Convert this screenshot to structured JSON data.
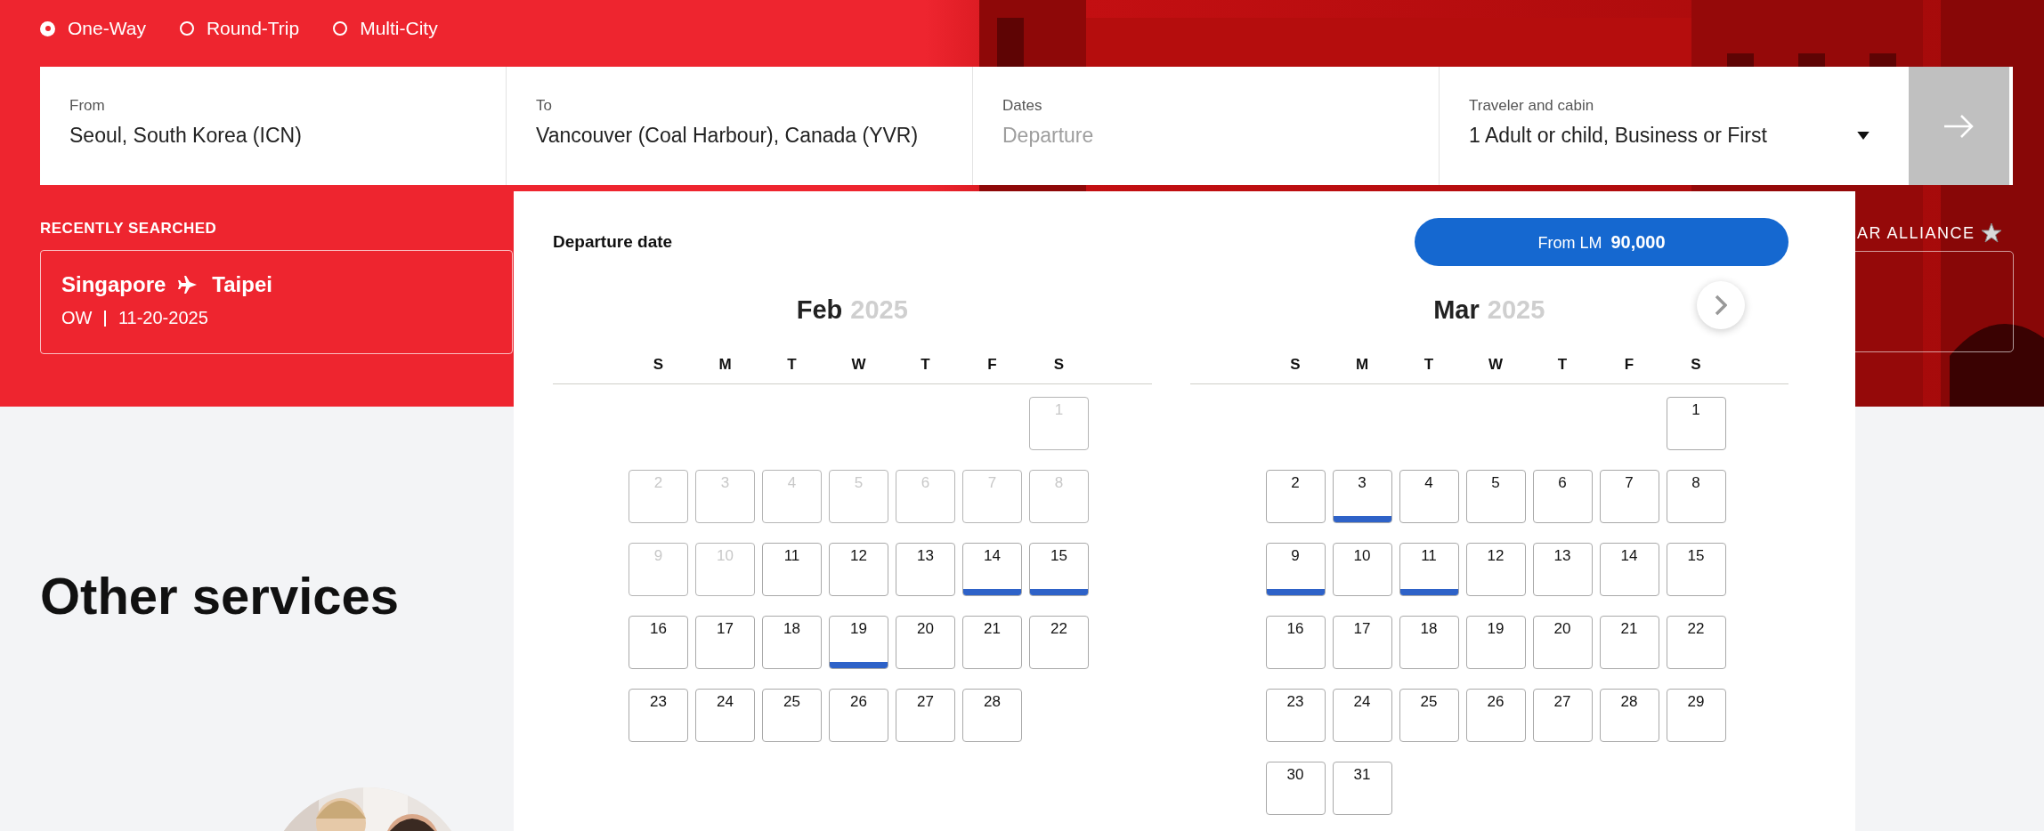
{
  "trip_types": [
    {
      "label": "One-Way",
      "selected": true
    },
    {
      "label": "Round-Trip",
      "selected": false
    },
    {
      "label": "Multi-City",
      "selected": false
    }
  ],
  "search_fields": [
    {
      "kind": "text",
      "label": "From",
      "value": "Seoul, South Korea (ICN)"
    },
    {
      "kind": "text",
      "label": "To",
      "value": "Vancouver (Coal Harbour), Canada (YVR)"
    },
    {
      "kind": "date",
      "label": "Dates",
      "placeholder": "Departure"
    },
    {
      "kind": "dropdown",
      "label": "Traveler and cabin",
      "value": "1 Adult or child, Business or First"
    }
  ],
  "recently_searched": {
    "heading": "RECENTLY SEARCHED",
    "items": [
      {
        "from": "Singapore",
        "to": "Taipei",
        "trip": "OW",
        "date": "11-20-2025"
      }
    ]
  },
  "partner_logo": {
    "text": "AR ALLIANCE"
  },
  "section_heading": "Other services",
  "date_picker": {
    "title": "Departure date",
    "price_button": "From LM  **90,000**",
    "months": [
      {
        "month": "Feb",
        "year": "2025",
        "weekdays": [
          "S",
          "M",
          "T",
          "W",
          "T",
          "F",
          "S"
        ],
        "weeks": [
          {
            "kind": "lead",
            "days": [
              {
                "day": "1",
                "disabled": true,
                "available": false
              }
            ]
          },
          {
            "kind": "week",
            "days": [
              {
                "day": "2",
                "disabled": true,
                "available": false
              },
              {
                "day": "3",
                "disabled": true,
                "available": false
              },
              {
                "day": "4",
                "disabled": true,
                "available": false
              },
              {
                "day": "5",
                "disabled": true,
                "available": false
              },
              {
                "day": "6",
                "disabled": true,
                "available": false
              },
              {
                "day": "7",
                "disabled": true,
                "available": false
              },
              {
                "day": "8",
                "disabled": true,
                "available": false
              }
            ]
          },
          {
            "kind": "week",
            "days": [
              {
                "day": "9",
                "disabled": true,
                "available": false
              },
              {
                "day": "10",
                "disabled": true,
                "available": false
              },
              {
                "day": "11",
                "disabled": false,
                "available": false
              },
              {
                "day": "12",
                "disabled": false,
                "available": false
              },
              {
                "day": "13",
                "disabled": false,
                "available": false
              },
              {
                "day": "14",
                "disabled": false,
                "available": true
              },
              {
                "day": "15",
                "disabled": false,
                "available": true
              }
            ]
          },
          {
            "kind": "week",
            "days": [
              {
                "day": "16",
                "disabled": false,
                "available": false
              },
              {
                "day": "17",
                "disabled": false,
                "available": false
              },
              {
                "day": "18",
                "disabled": false,
                "available": false
              },
              {
                "day": "19",
                "disabled": false,
                "available": true
              },
              {
                "day": "20",
                "disabled": false,
                "available": false
              },
              {
                "day": "21",
                "disabled": false,
                "available": false
              },
              {
                "day": "22",
                "disabled": false,
                "available": false
              }
            ]
          },
          {
            "kind": "week",
            "days": [
              {
                "day": "23",
                "disabled": false,
                "available": false
              },
              {
                "day": "24",
                "disabled": false,
                "available": false
              },
              {
                "day": "25",
                "disabled": false,
                "available": false
              },
              {
                "day": "26",
                "disabled": false,
                "available": false
              },
              {
                "day": "27",
                "disabled": false,
                "available": false
              },
              {
                "day": "28",
                "disabled": false,
                "available": false
              }
            ]
          }
        ]
      },
      {
        "month": "Mar",
        "year": "2025",
        "weekdays": [
          "S",
          "M",
          "T",
          "W",
          "T",
          "F",
          "S"
        ],
        "weeks": [
          {
            "kind": "lead",
            "days": [
              {
                "day": "1",
                "disabled": false,
                "available": false
              }
            ]
          },
          {
            "kind": "week",
            "days": [
              {
                "day": "2",
                "disabled": false,
                "available": false
              },
              {
                "day": "3",
                "disabled": false,
                "available": true
              },
              {
                "day": "4",
                "disabled": false,
                "available": false
              },
              {
                "day": "5",
                "disabled": false,
                "available": false
              },
              {
                "day": "6",
                "disabled": false,
                "available": false
              },
              {
                "day": "7",
                "disabled": false,
                "available": false
              },
              {
                "day": "8",
                "disabled": false,
                "available": false
              }
            ]
          },
          {
            "kind": "week",
            "days": [
              {
                "day": "9",
                "disabled": false,
                "available": true
              },
              {
                "day": "10",
                "disabled": false,
                "available": false
              },
              {
                "day": "11",
                "disabled": false,
                "available": true
              },
              {
                "day": "12",
                "disabled": false,
                "available": false
              },
              {
                "day": "13",
                "disabled": false,
                "available": false
              },
              {
                "day": "14",
                "disabled": false,
                "available": false
              },
              {
                "day": "15",
                "disabled": false,
                "available": false
              }
            ]
          },
          {
            "kind": "week",
            "days": [
              {
                "day": "16",
                "disabled": false,
                "available": false
              },
              {
                "day": "17",
                "disabled": false,
                "available": false
              },
              {
                "day": "18",
                "disabled": false,
                "available": false
              },
              {
                "day": "19",
                "disabled": false,
                "available": false
              },
              {
                "day": "20",
                "disabled": false,
                "available": false
              },
              {
                "day": "21",
                "disabled": false,
                "available": false
              },
              {
                "day": "22",
                "disabled": false,
                "available": false
              }
            ]
          },
          {
            "kind": "week",
            "days": [
              {
                "day": "23",
                "disabled": false,
                "available": false
              },
              {
                "day": "24",
                "disabled": false,
                "available": false
              },
              {
                "day": "25",
                "disabled": false,
                "available": false
              },
              {
                "day": "26",
                "disabled": false,
                "available": false
              },
              {
                "day": "27",
                "disabled": false,
                "available": false
              },
              {
                "day": "28",
                "disabled": false,
                "available": false
              },
              {
                "day": "29",
                "disabled": false,
                "available": false
              }
            ]
          },
          {
            "kind": "week",
            "days": [
              {
                "day": "30",
                "disabled": false,
                "available": false
              },
              {
                "day": "31",
                "disabled": false,
                "available": false
              }
            ]
          }
        ]
      }
    ]
  }
}
